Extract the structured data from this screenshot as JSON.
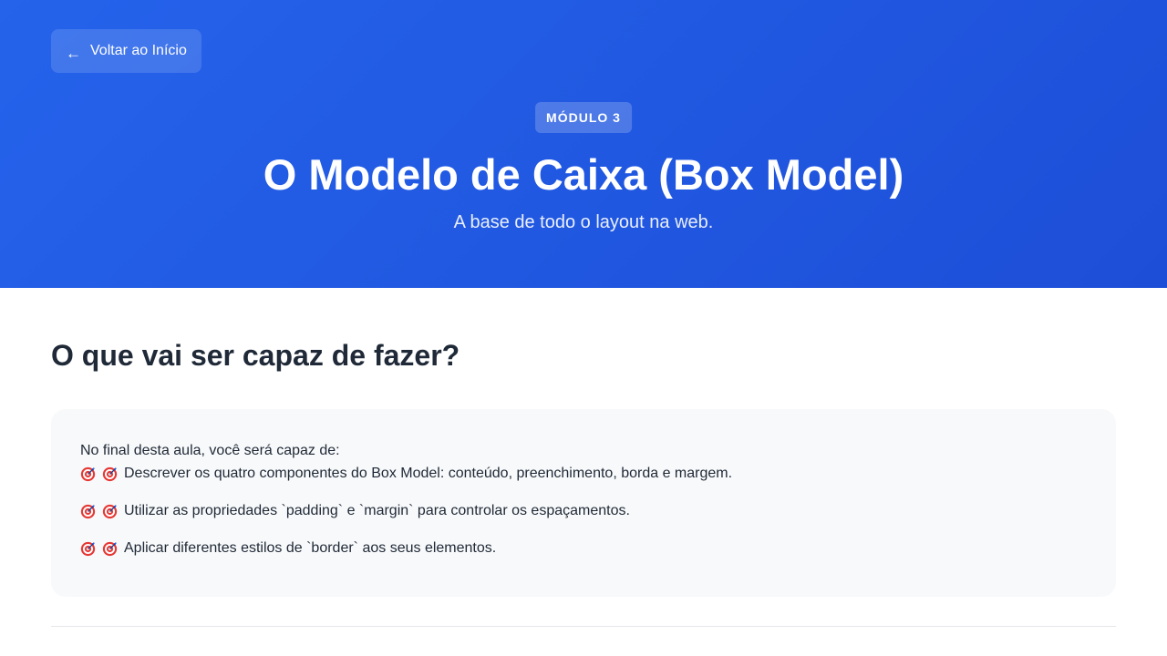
{
  "hero": {
    "back_label": "Voltar ao Início",
    "back_arrow": "←",
    "badge": "MÓDULO 3",
    "title": "O Modelo de Caixa (Box Model)",
    "subtitle": "A base de todo o layout na web.",
    "gradient_start": "#2563eb",
    "gradient_end": "#1d4ed8"
  },
  "objectives": {
    "heading": "O que vai ser capaz de fazer?",
    "intro": "No final desta aula, você será capaz de:",
    "icon": "target-icon",
    "items": [
      "Descrever os quatro componentes do Box Model: conteúdo, preenchimento, borda e margem.",
      "Utilizar as propriedades `padding` e `margin` para controlar os espaçamentos.",
      "Aplicar diferentes estilos de `border` aos seus elementos."
    ]
  }
}
